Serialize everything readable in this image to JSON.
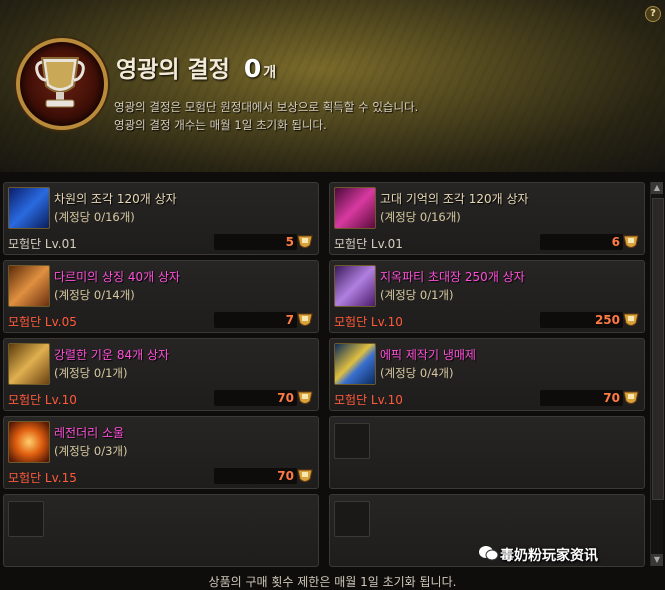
{
  "header": {
    "title": "영광의 결정",
    "count": "0",
    "unit": "개",
    "desc_line1": "영광의 결정은 모험단 원정대에서 보상으로 획득할 수 있습니다.",
    "desc_line2": "영광의 결정 개수는 매월 1일 초기화 됩니다.",
    "help_label": "?"
  },
  "items": [
    {
      "name": "차원의 조각 120개 상자",
      "limit": "(계정당 0/16개)",
      "req": "모험단 Lv.01",
      "price": "5",
      "name_color": "#e8d8b6",
      "req_color": "#d6cfc0",
      "icon": "dimension-shard-box-icon"
    },
    {
      "name": "고대 기억의 조각 120개 상자",
      "limit": "(계정당 0/16개)",
      "req": "모험단 Lv.01",
      "price": "6",
      "name_color": "#e8d8b6",
      "req_color": "#d6cfc0",
      "icon": "ancient-memory-box-icon"
    },
    {
      "name": "다르미의 상징 40개 상자",
      "limit": "(계정당 0/14개)",
      "req": "모험단 Lv.05",
      "price": "7",
      "name_color": "#ff4fd8",
      "req_color": "#ff5a3a",
      "icon": "darmi-symbol-box-icon"
    },
    {
      "name": "지옥파티 초대장 250개 상자",
      "limit": "(계정당 0/1개)",
      "req": "모험단 Lv.10",
      "price": "250",
      "name_color": "#ff4fd8",
      "req_color": "#ff5a3a",
      "icon": "hell-party-invite-box-icon"
    },
    {
      "name": "강렬한 기운 84개 상자",
      "limit": "(계정당 0/1개)",
      "req": "모험단 Lv.10",
      "price": "70",
      "name_color": "#ff4fd8",
      "req_color": "#ff5a3a",
      "icon": "intense-aura-box-icon"
    },
    {
      "name": "에픽 제작기 냉매제",
      "limit": "(계정당 0/4개)",
      "req": "모험단 Lv.10",
      "price": "70",
      "name_color": "#ff4fd8",
      "req_color": "#ff5a3a",
      "icon": "epic-crafting-coolant-icon"
    },
    {
      "name": "레전더리 소울",
      "limit": "(계정당 0/3개)",
      "req": "모험단 Lv.15",
      "price": "70",
      "name_color": "#ff4fd8",
      "req_color": "#ff5a3a",
      "icon": "legendary-soul-icon"
    }
  ],
  "colors": {
    "price": "#ff7a45",
    "locked_name": "#ff4fd8",
    "locked_req": "#ff5a3a"
  },
  "footer": "상품의 구매 횟수 제한은 매월 1일 초기화 됩니다.",
  "watermark": "毒奶粉玩家资讯"
}
